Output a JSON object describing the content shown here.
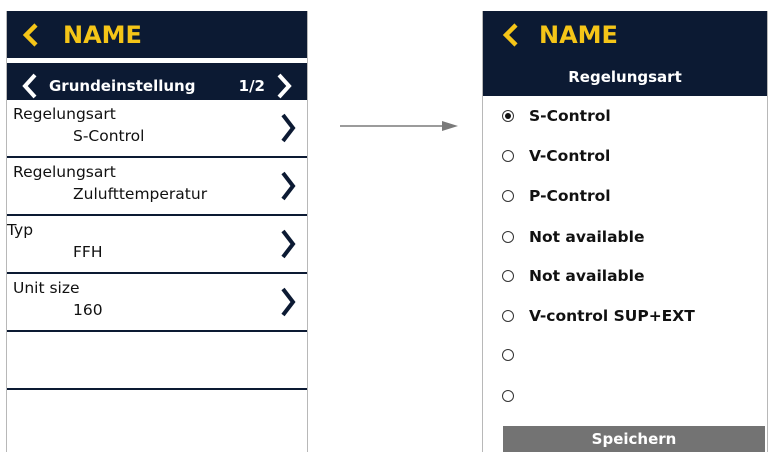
{
  "left": {
    "title": "NAME",
    "section": "Grundeinstellung",
    "page": "1/2",
    "rows": [
      {
        "label": "Regelungsart",
        "value": "S-Control"
      },
      {
        "label": "Regelungsart",
        "value": "Zulufttemperatur"
      },
      {
        "label": "Typ",
        "value": "FFH"
      },
      {
        "label": "Unit size",
        "value": "160"
      }
    ]
  },
  "right": {
    "title": "NAME",
    "heading": "Regelungsart",
    "options": [
      {
        "label": "S-Control",
        "selected": true
      },
      {
        "label": "V-Control",
        "selected": false
      },
      {
        "label": "P-Control",
        "selected": false
      },
      {
        "label": "Not available",
        "selected": false
      },
      {
        "label": "Not available",
        "selected": false
      },
      {
        "label": "V-control SUP+EXT",
        "selected": false
      },
      {
        "label": "",
        "selected": false
      },
      {
        "label": "",
        "selected": false
      }
    ],
    "save_label": "Speichern"
  },
  "colors": {
    "header_bg": "#0c1a33",
    "accent": "#f5c518",
    "save_bg": "#737373"
  },
  "icons": {
    "back": "chevron-left-icon",
    "next": "chevron-right-icon",
    "flow": "arrow-right-icon"
  }
}
